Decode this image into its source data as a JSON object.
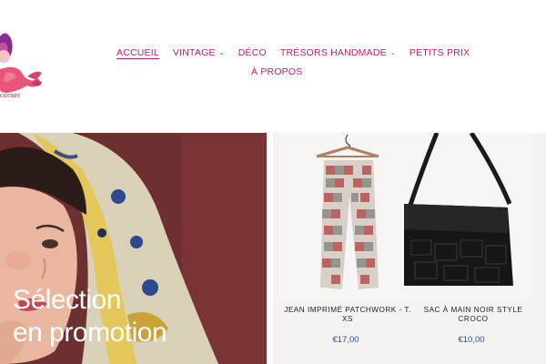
{
  "logo": {
    "text": "corner"
  },
  "nav": {
    "items": [
      {
        "label": "ACCUEIL",
        "active": true,
        "has_dropdown": false
      },
      {
        "label": "VINTAGE",
        "active": false,
        "has_dropdown": true
      },
      {
        "label": "DÉCO",
        "active": false,
        "has_dropdown": false
      },
      {
        "label": "TRÉSORS HANDMADE",
        "active": false,
        "has_dropdown": true
      },
      {
        "label": "PETITS PRIX",
        "active": false,
        "has_dropdown": false
      },
      {
        "label": "À PROPOS",
        "active": false,
        "has_dropdown": false
      }
    ]
  },
  "hero": {
    "title_line1": "Sélection",
    "title_line2": "en promotion"
  },
  "products": [
    {
      "name": "JEAN IMPRIMÉ PATCHWORK - T. XS",
      "price": "€17,00"
    },
    {
      "name": "SAC À MAIN NOIR STYLE CROCO",
      "price": "€10,00"
    }
  ],
  "colors": {
    "brand": "#b0246b",
    "price": "#2b4d9a",
    "hero_bg": "#6b2e30"
  }
}
